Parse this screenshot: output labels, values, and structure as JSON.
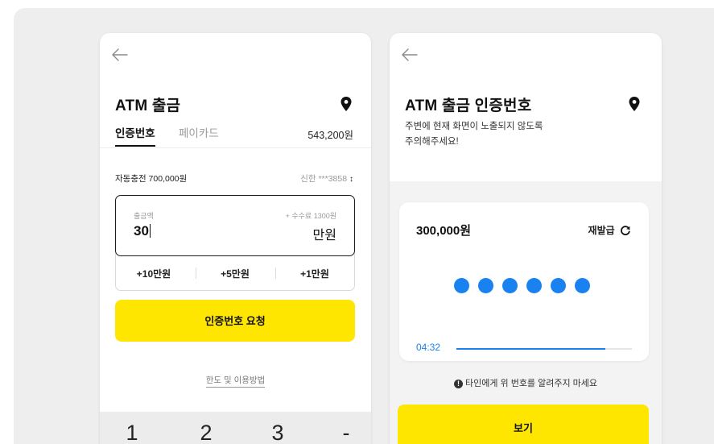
{
  "colors": {
    "accent_yellow": "#ffe600",
    "accent_blue": "#1a82f0",
    "background": "#eeeeee"
  },
  "withdraw_screen": {
    "back_icon": "arrow-left-icon",
    "title": "ATM 출금",
    "location_icon": "map-pin-icon",
    "tabs": [
      {
        "label": "인증번호",
        "active": true
      },
      {
        "label": "페이카드",
        "active": false
      }
    ],
    "balance": "543,200원",
    "auto_charge": "자동충전 700,000원",
    "account": "신한 ***3858",
    "account_sort_icon": "sort-arrows-icon",
    "amount_label": "출금액",
    "fee": "+ 수수료 1300원",
    "amount_value": "30",
    "amount_unit": "만원",
    "quick_amounts": [
      "+10만원",
      "+5만원",
      "+1만원"
    ],
    "request_button": "인증번호 요청",
    "help_link": "한도 및 이용방법",
    "keypad": [
      "1",
      "2",
      "3",
      "-"
    ]
  },
  "code_screen": {
    "back_icon": "arrow-left-icon",
    "title": "ATM 출금 인증번호",
    "location_icon": "map-pin-icon",
    "subtitle_line1": "주변에 현재 화면이 노출되지 않도록",
    "subtitle_line2": "주의해주세요!",
    "amount": "300,000원",
    "reissue_label": "재발급",
    "reissue_icon": "refresh-icon",
    "code_length": 6,
    "timer": "04:32",
    "timer_progress": 0.85,
    "warning_icon": "exclamation-circle-icon",
    "warning": "타인에게 위 번호를 알려주지 마세요",
    "view_button": "보기"
  }
}
